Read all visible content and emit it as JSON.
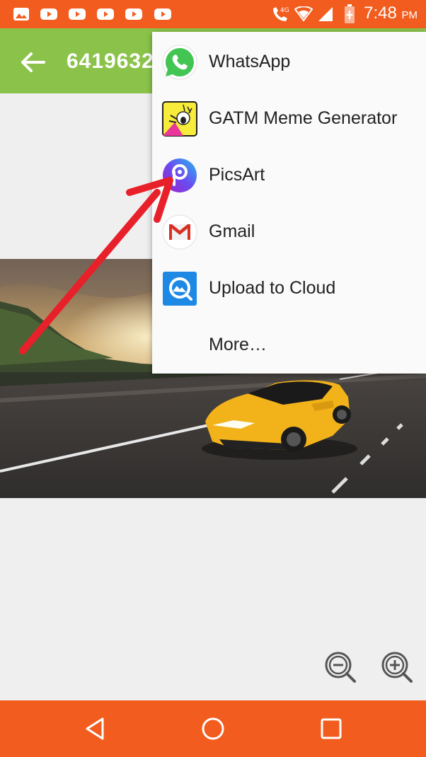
{
  "status_bar": {
    "time": "7:48",
    "ampm": "PM",
    "network": "4G",
    "notification_icons": [
      "image-icon",
      "youtube-icon",
      "youtube-icon",
      "youtube-icon",
      "youtube-icon",
      "youtube-icon"
    ]
  },
  "app_bar": {
    "title": "6419632"
  },
  "share_menu": {
    "items": [
      {
        "label": "WhatsApp",
        "icon": "whatsapp-icon"
      },
      {
        "label": "GATM Meme Generator",
        "icon": "meme-generator-icon"
      },
      {
        "label": "PicsArt",
        "icon": "picsart-icon"
      },
      {
        "label": "Gmail",
        "icon": "gmail-icon"
      },
      {
        "label": "Upload to Cloud",
        "icon": "upload-cloud-icon"
      },
      {
        "label": "More…",
        "icon": ""
      }
    ]
  },
  "zoom": {
    "out_icon": "zoom-out-icon",
    "in_icon": "zoom-in-icon"
  },
  "nav_bar": {
    "back_icon": "nav-back-icon",
    "home_icon": "nav-home-icon",
    "recents_icon": "nav-recents-icon"
  },
  "colors": {
    "status_bar": "#f25c1e",
    "app_bar": "#8bc34a",
    "nav_bar": "#f25c1e",
    "arrow": "#e8202a",
    "car": "#f2b21a"
  }
}
